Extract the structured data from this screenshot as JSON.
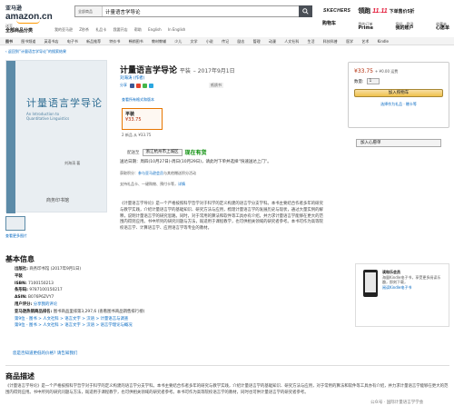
{
  "header": {
    "logo_cn": "亚马逊",
    "logo_en": "amazon.cn",
    "logo_sub": "Prime 会员",
    "search_category": "全部商品",
    "search_query": "计量语言学导论",
    "ad_brand": "SKECHERS",
    "ad_text": "领跑",
    "ad_event": "11.11",
    "ad_tail": "下单售价5折",
    "deliver_line1": "送至",
    "deliver_line2": "全部商品分类",
    "links": [
      "我的亚马逊",
      "Z秒杀",
      "礼品卡",
      "我要开店",
      "帮助",
      "English",
      "In English"
    ],
    "right_items": [
      {
        "top": "",
        "bottom": "购物车"
      },
      {
        "top": "我的订单",
        "bottom": "Prime"
      },
      {
        "top": "您好，登录",
        "bottom": "我的账户"
      },
      {
        "top": "收藏夹",
        "bottom": "心愿单"
      }
    ]
  },
  "categories": [
    "图书",
    "图书频道",
    "英语书店",
    "电子书",
    "新品推荐",
    "特价书",
    "畅销图书",
    "教材教辅",
    "少儿",
    "文学",
    "小说",
    "传记",
    "励志",
    "管理",
    "动漫",
    "人文社科",
    "生活",
    "科技科普",
    "医学",
    "艺术",
    "Kindle"
  ],
  "breadcrumb": "‹ 返回到“计量语言学导论”的搜索结果",
  "cover": {
    "title": "计量语言学导论",
    "subtitle": "An Introduction to Quantitative Linguistics",
    "author": "刘海涛 著",
    "publisher": "商务印书馆"
  },
  "thumb_label": "查看更多图片",
  "product": {
    "title": "计量语言学导论",
    "binding": "平装",
    "date": "– 2017年9月1日",
    "author": "刘海涛 (作者)",
    "share_label": "分享",
    "badge": "纸质书",
    "price_link": "查看所有格式和版本",
    "price_label": "平装",
    "price_value": "¥33.75",
    "price_sub": "2 新品 从 ¥33.75",
    "ship_to": "配送至",
    "ship_location": "浙江杭州市上城区",
    "stock": "现在有货",
    "ship_note": "送达日期：周四(10月27日)-周日(10月29日)，请此时下单并选择“快速送达上门”。",
    "points1_a": "获取积分：",
    "points1_b": "参与亚马逊会员",
    "points1_c": "与其他赠送积分活动",
    "points2_a": "支持礼品卡、一键购物、预付卡等，",
    "points2_b": "详情",
    "description": "《计量语言学导论》是一个严格按照科学哲学对于科学的定义构建的语言学分支学科。本书主要结合作者多年的研究与教学实践，介绍计量语言学的基础知识、研究方法与应用，梳理计量语言学的发展历史与现状，通过大量实例的解释，说明计量语言学的研究思路。同时，对于常用的算法和软件等工具亦有介绍，并力求计量语言学能够在更大的范围内得到应用。书中所列的研究问题与方法，既适用于课程教学，也可供相关领域的研究者参考。本书可作为高等院校语言学、计算语言学、应用语言学等专业的教材。"
  },
  "buybox": {
    "price": "¥33.75",
    "free_ship": "+ ¥0.00 运费",
    "qty_label": "数量:",
    "qty_value": "1",
    "cart": "加入购物车",
    "gift": "选择作为礼品 · 赠卡等"
  },
  "wishlist": "加入心愿单",
  "basic": {
    "heading": "基本信息",
    "rows": [
      {
        "k": "出版社:",
        "v": "商务印书馆 (2017年9月1日)"
      },
      {
        "k": "平装",
        "v": ""
      },
      {
        "k": "ISBN:",
        "v": "7100150213"
      },
      {
        "k": "条形码:",
        "v": "9787100150217"
      },
      {
        "k": "ASIN:",
        "v": "B076P6ZVY7"
      },
      {
        "k": "用户评分:",
        "v": "分享我的评论"
      },
      {
        "k": "亚马逊热销商品排名:",
        "v": "图书商品里排第3,297,6 (查看图书商品销售排行榜)"
      },
      {
        "k": "",
        "v": "第9位 - 图书 > 人文社科 > 语言文字 > 汉语 > 计量语言与调查"
      },
      {
        "k": "",
        "v": "第9位 - 图书 > 人文社科 > 语言文字 > 汉语 > 语言学理论与概况"
      }
    ]
  },
  "kindle_ad": {
    "title": "读和乐会员",
    "text": "海量Kindle电子书，享受更多阅读乐趣，即刻下载，",
    "link": "阅读Kindle电子书"
  },
  "report": "您是否知道更低的价格? 请告知我们",
  "desc_heading": "商品描述",
  "desc2": "《计量语言学导论》是一个严格按照科学哲学对于科学的定义构建的语言学分支学科。本书主要结合作者多年的研究与教学实践，介绍计量语言学的基础知识、研究方法与应用，对于常用的算法和软件等工具亦有介绍，并力求计量语言学能够在更大的范围内得到应用。书中所列的研究问题与方法，既适用于课程教学，也可供相关领域的研究者参考。本书可作为高等院校语言学的教材，同时也可供计量语言学的研究者参考。",
  "watermark": "公众号 · 国际计量语言学学会"
}
